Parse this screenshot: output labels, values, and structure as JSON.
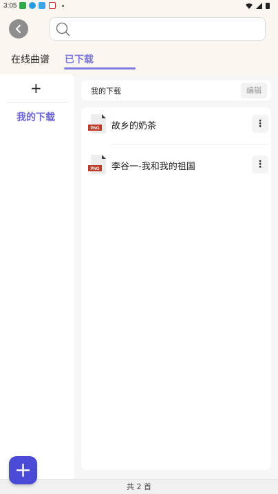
{
  "status_bar": {
    "time": "3:05"
  },
  "search": {
    "placeholder": "",
    "value": ""
  },
  "tabs": [
    {
      "label": "在线曲谱",
      "active": false
    },
    {
      "label": "已下载",
      "active": true
    }
  ],
  "sidebar": {
    "add_symbol": "+",
    "items": [
      {
        "label": "我的下载",
        "selected": true
      }
    ]
  },
  "folder_bar": {
    "title": "我的下载",
    "edit_label": "编辑"
  },
  "files": [
    {
      "name": "故乡的奶茶",
      "type_badge": "PNG"
    },
    {
      "name": "李谷一-我和我的祖国",
      "type_badge": "PNG"
    }
  ],
  "footer": {
    "count_text": "共 2 首"
  },
  "colors": {
    "accent": "#7b76e0",
    "fab": "#4a4ad6",
    "header_bg": "#fbf6ef"
  },
  "icons": [
    "back-arrow-icon",
    "search-icon",
    "plus-icon",
    "file-png-icon",
    "more-vertical-icon"
  ]
}
